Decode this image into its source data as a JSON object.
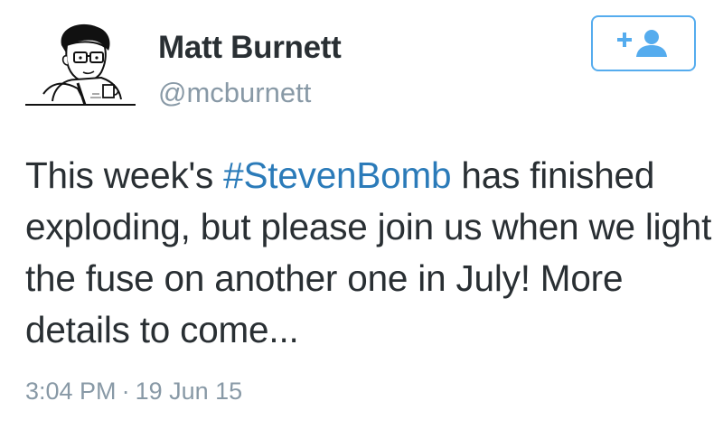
{
  "user": {
    "display_name": "Matt Burnett",
    "handle": "@mcburnett",
    "avatar_icon": "cartoon-avatar-icon"
  },
  "follow_button": {
    "icon": "follow-user-plus-icon",
    "accent_color": "#55acee"
  },
  "tweet": {
    "text_before": "This week's ",
    "hashtag": "#StevenBomb",
    "text_after": " has finished exploding, but please join us when we light the fuse on another one in July! More details to come...",
    "hashtag_color": "#2b7bb9"
  },
  "meta": {
    "time": "3:04 PM",
    "separator": "·",
    "date": "19 Jun 15"
  }
}
